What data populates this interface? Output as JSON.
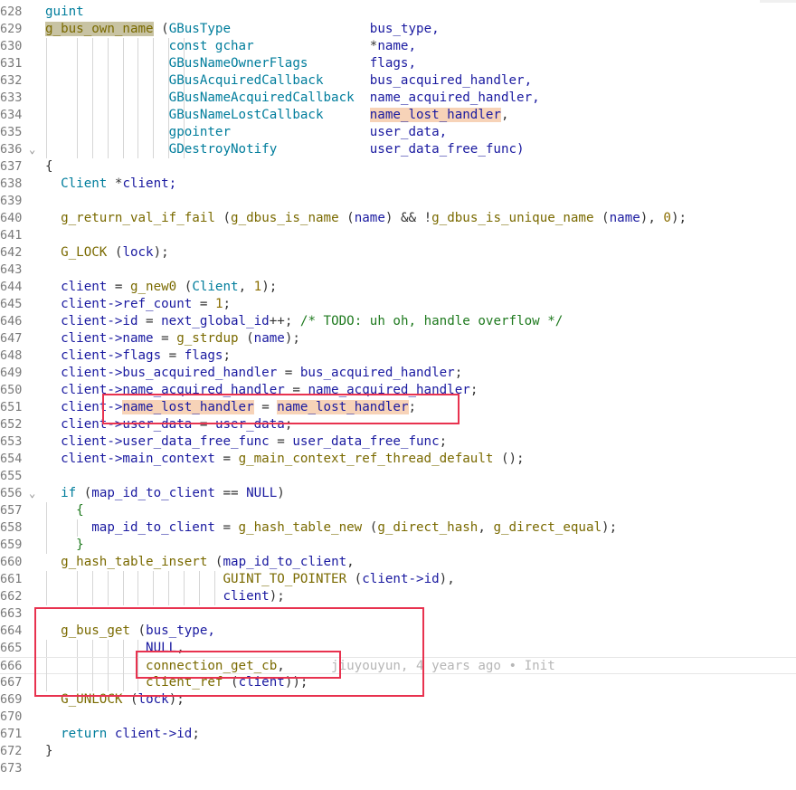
{
  "editor": {
    "blame_annotation": "jiuyouyun, 4 years ago • Init",
    "lines": [
      {
        "num": "628",
        "fold": false,
        "tokens": [
          [
            "guint",
            "ty"
          ]
        ],
        "guides": 0
      },
      {
        "num": "629",
        "fold": false,
        "tokens": [
          [
            "g_bus_own_name",
            "fn hl-olive"
          ],
          [
            " (",
            "op"
          ],
          [
            "GBusType",
            "ty"
          ],
          [
            "                  ",
            "op"
          ],
          [
            "bus_type,",
            "id"
          ]
        ],
        "guides": 0
      },
      {
        "num": "630",
        "fold": false,
        "tokens": [
          [
            "                ",
            "op"
          ],
          [
            "const gchar",
            "ty"
          ],
          [
            "               *",
            "op"
          ],
          [
            "name,",
            "id"
          ]
        ],
        "guides": 9
      },
      {
        "num": "631",
        "fold": false,
        "tokens": [
          [
            "                ",
            "op"
          ],
          [
            "GBusNameOwnerFlags",
            "ty"
          ],
          [
            "        ",
            "op"
          ],
          [
            "flags,",
            "id"
          ]
        ],
        "guides": 9
      },
      {
        "num": "632",
        "fold": false,
        "tokens": [
          [
            "                ",
            "op"
          ],
          [
            "GBusAcquiredCallback",
            "ty"
          ],
          [
            "      ",
            "op"
          ],
          [
            "bus_acquired_handler,",
            "id"
          ]
        ],
        "guides": 9
      },
      {
        "num": "633",
        "fold": false,
        "tokens": [
          [
            "                ",
            "op"
          ],
          [
            "GBusNameAcquiredCallback",
            "ty"
          ],
          [
            "  ",
            "op"
          ],
          [
            "name_acquired_handler,",
            "id"
          ]
        ],
        "guides": 9
      },
      {
        "num": "634",
        "fold": false,
        "tokens": [
          [
            "                ",
            "op"
          ],
          [
            "GBusNameLostCallback",
            "ty"
          ],
          [
            "      ",
            "op"
          ],
          [
            "name_lost_handler",
            "id hl-word"
          ],
          [
            ",",
            "op"
          ]
        ],
        "guides": 9
      },
      {
        "num": "635",
        "fold": false,
        "tokens": [
          [
            "                ",
            "op"
          ],
          [
            "gpointer",
            "ty"
          ],
          [
            "                  ",
            "op"
          ],
          [
            "user_data,",
            "id"
          ]
        ],
        "guides": 9
      },
      {
        "num": "636",
        "fold": true,
        "tokens": [
          [
            "                ",
            "op"
          ],
          [
            "GDestroyNotify",
            "ty"
          ],
          [
            "            ",
            "op"
          ],
          [
            "user_data_free_func)",
            "id"
          ]
        ],
        "guides": 9
      },
      {
        "num": "637",
        "fold": false,
        "tokens": [
          [
            "{",
            "op"
          ]
        ],
        "guides": 0
      },
      {
        "num": "638",
        "fold": false,
        "tokens": [
          [
            "  ",
            "op"
          ],
          [
            "Client",
            "ty"
          ],
          [
            " *",
            "op"
          ],
          [
            "client;",
            "id"
          ]
        ],
        "guides": 0
      },
      {
        "num": "639",
        "fold": false,
        "tokens": [],
        "guides": 0
      },
      {
        "num": "640",
        "fold": false,
        "tokens": [
          [
            "  ",
            "op"
          ],
          [
            "g_return_val_if_fail",
            "fn"
          ],
          [
            " (",
            "op"
          ],
          [
            "g_dbus_is_name",
            "fn"
          ],
          [
            " (",
            "op"
          ],
          [
            "name",
            "id"
          ],
          [
            ") && !",
            "op"
          ],
          [
            "g_dbus_is_unique_name",
            "fn"
          ],
          [
            " (",
            "op"
          ],
          [
            "name",
            "id"
          ],
          [
            "), ",
            "op"
          ],
          [
            "0",
            "nm"
          ],
          [
            ");",
            "op"
          ]
        ],
        "guides": 0
      },
      {
        "num": "641",
        "fold": false,
        "tokens": [],
        "guides": 0
      },
      {
        "num": "642",
        "fold": false,
        "tokens": [
          [
            "  ",
            "op"
          ],
          [
            "G_LOCK",
            "fn"
          ],
          [
            " (",
            "op"
          ],
          [
            "lock",
            "id"
          ],
          [
            ");",
            "op"
          ]
        ],
        "guides": 0
      },
      {
        "num": "643",
        "fold": false,
        "tokens": [],
        "guides": 0
      },
      {
        "num": "644",
        "fold": false,
        "tokens": [
          [
            "  ",
            "op"
          ],
          [
            "client",
            "id"
          ],
          [
            " = ",
            "op"
          ],
          [
            "g_new0",
            "fn"
          ],
          [
            " (",
            "op"
          ],
          [
            "Client",
            "ty"
          ],
          [
            ", ",
            "op"
          ],
          [
            "1",
            "nm"
          ],
          [
            ");",
            "op"
          ]
        ],
        "guides": 0
      },
      {
        "num": "645",
        "fold": false,
        "tokens": [
          [
            "  ",
            "op"
          ],
          [
            "client->ref_count",
            "id"
          ],
          [
            " = ",
            "op"
          ],
          [
            "1",
            "nm"
          ],
          [
            ";",
            "op"
          ]
        ],
        "guides": 0
      },
      {
        "num": "646",
        "fold": false,
        "tokens": [
          [
            "  ",
            "op"
          ],
          [
            "client->id",
            "id"
          ],
          [
            " = ",
            "op"
          ],
          [
            "next_global_id",
            "id"
          ],
          [
            "++; ",
            "op"
          ],
          [
            "/* TODO: uh oh, handle overflow */",
            "cm"
          ]
        ],
        "guides": 0
      },
      {
        "num": "647",
        "fold": false,
        "tokens": [
          [
            "  ",
            "op"
          ],
          [
            "client->name",
            "id"
          ],
          [
            " = ",
            "op"
          ],
          [
            "g_strdup",
            "fn"
          ],
          [
            " (",
            "op"
          ],
          [
            "name",
            "id"
          ],
          [
            ");",
            "op"
          ]
        ],
        "guides": 0
      },
      {
        "num": "648",
        "fold": false,
        "tokens": [
          [
            "  ",
            "op"
          ],
          [
            "client->flags",
            "id"
          ],
          [
            " = ",
            "op"
          ],
          [
            "flags",
            "id"
          ],
          [
            ";",
            "op"
          ]
        ],
        "guides": 0
      },
      {
        "num": "649",
        "fold": false,
        "tokens": [
          [
            "  ",
            "op"
          ],
          [
            "client->bus_acquired_handler",
            "id"
          ],
          [
            " = ",
            "op"
          ],
          [
            "bus_acquired_handler",
            "id"
          ],
          [
            ";",
            "op"
          ]
        ],
        "guides": 0
      },
      {
        "num": "650",
        "fold": false,
        "tokens": [
          [
            "  ",
            "op"
          ],
          [
            "client->name_acquired_handler",
            "id"
          ],
          [
            " = ",
            "op"
          ],
          [
            "name_acquired_handler",
            "id"
          ],
          [
            ";",
            "op"
          ]
        ],
        "guides": 0
      },
      {
        "num": "651",
        "fold": false,
        "tokens": [
          [
            "  ",
            "op"
          ],
          [
            "client->",
            "id"
          ],
          [
            "name_lost_handler",
            "id hl-word"
          ],
          [
            " = ",
            "op"
          ],
          [
            "name_lost_handler",
            "id hl-word"
          ],
          [
            ";",
            "op"
          ]
        ],
        "guides": 0
      },
      {
        "num": "652",
        "fold": false,
        "tokens": [
          [
            "  ",
            "op"
          ],
          [
            "client->user_data",
            "id"
          ],
          [
            " = ",
            "op"
          ],
          [
            "user_data",
            "id"
          ],
          [
            ";",
            "op"
          ]
        ],
        "guides": 0
      },
      {
        "num": "653",
        "fold": false,
        "tokens": [
          [
            "  ",
            "op"
          ],
          [
            "client->user_data_free_func",
            "id"
          ],
          [
            " = ",
            "op"
          ],
          [
            "user_data_free_func",
            "id"
          ],
          [
            ";",
            "op"
          ]
        ],
        "guides": 0
      },
      {
        "num": "654",
        "fold": false,
        "tokens": [
          [
            "  ",
            "op"
          ],
          [
            "client->main_context",
            "id"
          ],
          [
            " = ",
            "op"
          ],
          [
            "g_main_context_ref_thread_default",
            "fn"
          ],
          [
            " ();",
            "op"
          ]
        ],
        "guides": 0
      },
      {
        "num": "655",
        "fold": false,
        "tokens": [],
        "guides": 0
      },
      {
        "num": "656",
        "fold": true,
        "tokens": [
          [
            "  ",
            "op"
          ],
          [
            "if",
            "ty"
          ],
          [
            " (",
            "op"
          ],
          [
            "map_id_to_client",
            "id"
          ],
          [
            " == ",
            "op"
          ],
          [
            "NULL",
            "id"
          ],
          [
            ")",
            "op"
          ]
        ],
        "guides": 0
      },
      {
        "num": "657",
        "fold": false,
        "tokens": [
          [
            "    {",
            "cm"
          ]
        ],
        "guides": 1
      },
      {
        "num": "658",
        "fold": false,
        "tokens": [
          [
            "      ",
            "op"
          ],
          [
            "map_id_to_client",
            "id"
          ],
          [
            " = ",
            "op"
          ],
          [
            "g_hash_table_new",
            "fn"
          ],
          [
            " (",
            "op"
          ],
          [
            "g_direct_hash",
            "fn"
          ],
          [
            ", ",
            "op"
          ],
          [
            "g_direct_equal",
            "fn"
          ],
          [
            ");",
            "op"
          ]
        ],
        "guides": 2
      },
      {
        "num": "659",
        "fold": false,
        "tokens": [
          [
            "    }",
            "cm"
          ]
        ],
        "guides": 1
      },
      {
        "num": "660",
        "fold": false,
        "tokens": [
          [
            "  ",
            "op"
          ],
          [
            "g_hash_table_insert",
            "fn"
          ],
          [
            " (",
            "op"
          ],
          [
            "map_id_to_client",
            "id"
          ],
          [
            ",",
            "op"
          ]
        ],
        "guides": 0
      },
      {
        "num": "661",
        "fold": false,
        "tokens": [
          [
            "                       ",
            "op"
          ],
          [
            "GUINT_TO_POINTER",
            "fn"
          ],
          [
            " (",
            "op"
          ],
          [
            "client->id",
            "id"
          ],
          [
            "),",
            "op"
          ]
        ],
        "guides": 11
      },
      {
        "num": "662",
        "fold": false,
        "tokens": [
          [
            "                       ",
            "op"
          ],
          [
            "client",
            "id"
          ],
          [
            ");",
            "op"
          ]
        ],
        "guides": 11
      },
      {
        "num": "663",
        "fold": false,
        "tokens": [],
        "guides": 0
      },
      {
        "num": "664",
        "fold": false,
        "tokens": [
          [
            "  ",
            "op"
          ],
          [
            "g_bus_get",
            "fn"
          ],
          [
            " (",
            "op"
          ],
          [
            "bus_type,",
            "id"
          ]
        ],
        "guides": 0
      },
      {
        "num": "665",
        "fold": false,
        "tokens": [
          [
            "             ",
            "op"
          ],
          [
            "NULL",
            "id"
          ],
          [
            ",",
            "op"
          ]
        ],
        "guides": 6
      },
      {
        "num": "666",
        "fold": false,
        "tokens": [
          [
            "             ",
            "op"
          ],
          [
            "connection_get_cb",
            "fn"
          ],
          [
            ",",
            "op"
          ]
        ],
        "guides": 6,
        "current": true
      },
      {
        "num": "667",
        "fold": false,
        "tokens": [
          [
            "             ",
            "op"
          ],
          [
            "client_ref",
            "fn"
          ],
          [
            " (",
            "op"
          ],
          [
            "client",
            "id"
          ],
          [
            "));",
            "op"
          ]
        ],
        "guides": 6
      },
      {
        "num": "669",
        "fold": false,
        "tokens": [
          [
            "  ",
            "op"
          ],
          [
            "G_UNLOCK",
            "fn"
          ],
          [
            " (",
            "op"
          ],
          [
            "lock",
            "id"
          ],
          [
            ");",
            "op"
          ]
        ],
        "guides": 0
      },
      {
        "num": "670",
        "fold": false,
        "tokens": [],
        "guides": 0
      },
      {
        "num": "671",
        "fold": false,
        "tokens": [
          [
            "  ",
            "op"
          ],
          [
            "return",
            "ty"
          ],
          [
            " ",
            "op"
          ],
          [
            "client->id",
            "id"
          ],
          [
            ";",
            "op"
          ]
        ],
        "guides": 0
      },
      {
        "num": "672",
        "fold": false,
        "tokens": [
          [
            "}",
            "op"
          ]
        ],
        "guides": 0
      },
      {
        "num": "673",
        "fold": false,
        "tokens": [],
        "guides": 0
      }
    ]
  }
}
